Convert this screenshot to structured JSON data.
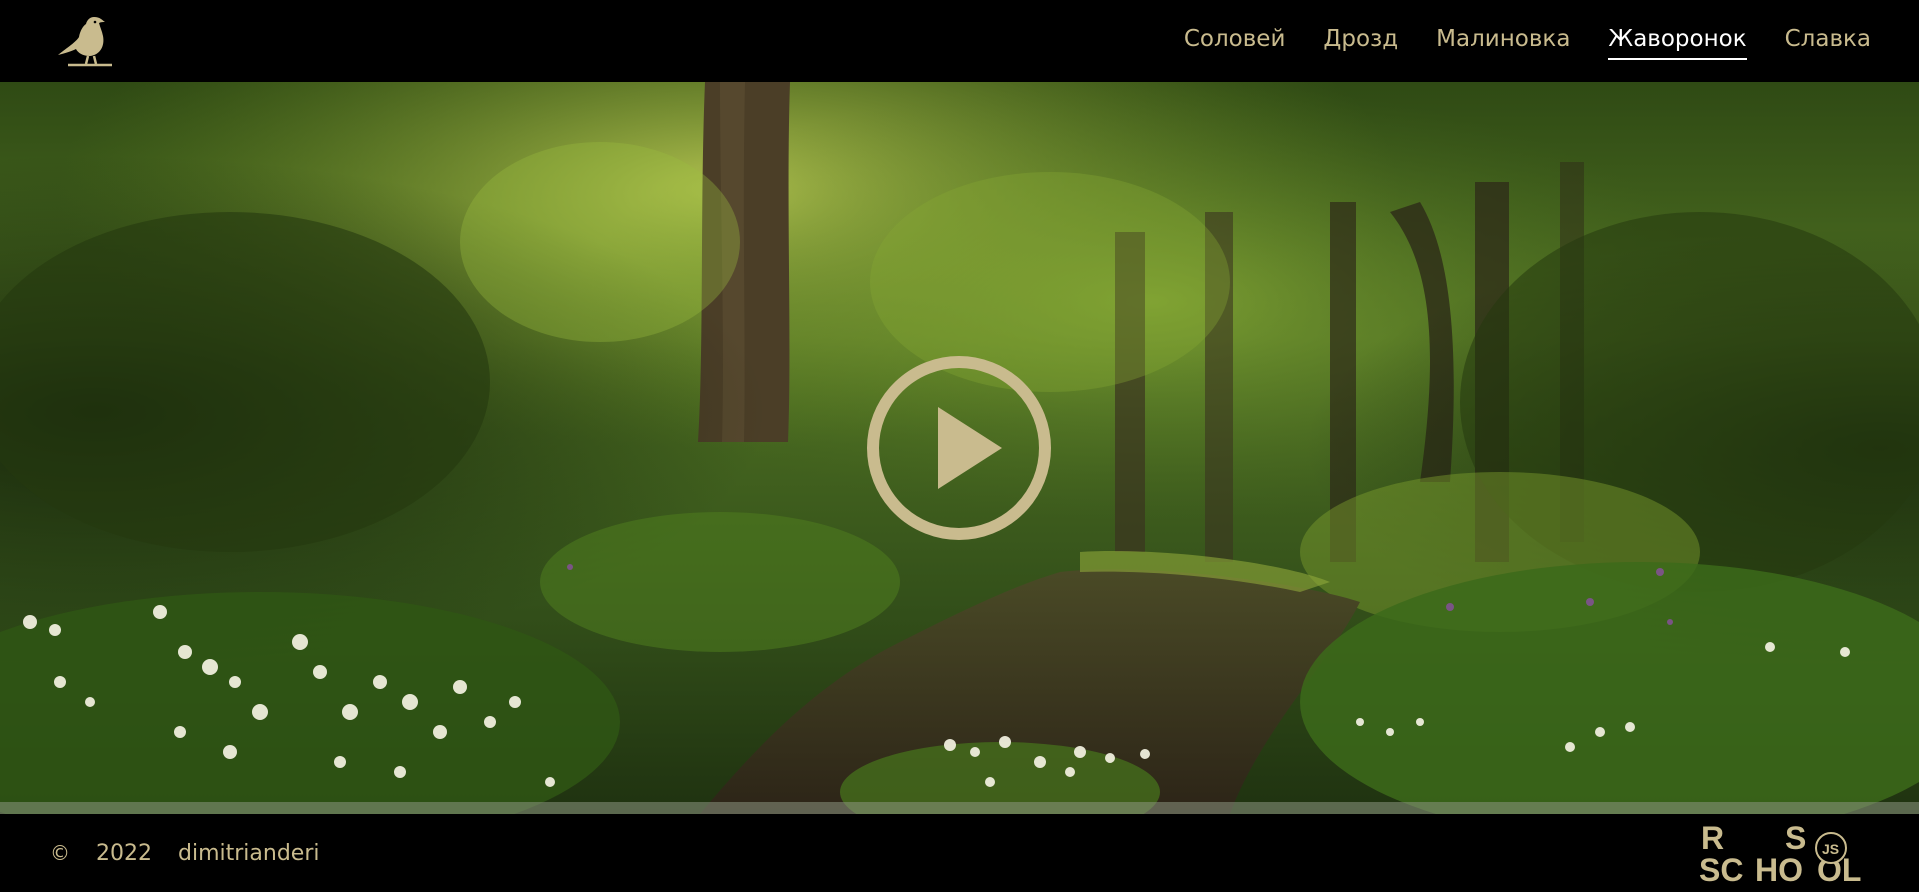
{
  "header": {
    "logo_icon": "bird-logo-icon",
    "nav": [
      {
        "label": "Соловей",
        "active": false
      },
      {
        "label": "Дрозд",
        "active": false
      },
      {
        "label": "Малиновка",
        "active": false
      },
      {
        "label": "Жаворонок",
        "active": true
      },
      {
        "label": "Славка",
        "active": false
      }
    ]
  },
  "hero": {
    "play_icon": "play-icon",
    "scene": "forest-path-background"
  },
  "footer": {
    "copyright_symbol": "©",
    "year": "2022",
    "author": "dimitrianderi",
    "school_logo_letters": [
      "R",
      "S",
      "SC",
      "HO",
      "OL",
      "JS"
    ]
  },
  "colors": {
    "accent": "#c9bb8e",
    "active_nav": "#ffffff",
    "background": "#000000"
  }
}
